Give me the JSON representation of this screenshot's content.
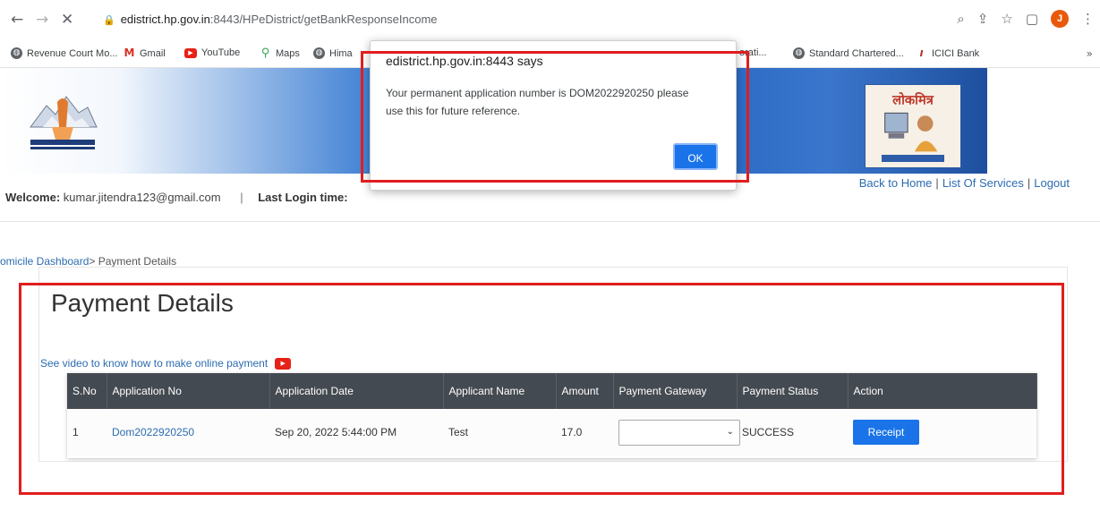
{
  "browser": {
    "url_domain": "edistrict.hp.gov.in",
    "url_path": ":8443/HPeDistrict/getBankResponseIncome",
    "avatar_letter": "J",
    "bookmarks": [
      "Revenue Court Mo...",
      "Gmail",
      "YouTube",
      "Maps",
      "Hima",
      "orati...",
      "Standard Chartered...",
      "ICICI Bank"
    ]
  },
  "header": {
    "welcome_label": "Welcome:",
    "welcome_user": "kumar.jitendra123@gmail.com",
    "separator": "|",
    "last_login_label": "Last Login time:",
    "links": [
      "Back to Home",
      "List Of Services",
      "Logout"
    ]
  },
  "breadcrumb": {
    "parent": "omicile Dashboard",
    "current": "> Payment Details"
  },
  "page": {
    "title": "Payment Details",
    "video_link": "See video to know how to make online payment"
  },
  "table": {
    "headers": [
      "S.No",
      "Application No",
      "Application Date",
      "Applicant Name",
      "Amount",
      "Payment Gateway",
      "Payment Status",
      "Action"
    ],
    "rows": [
      {
        "sno": "1",
        "application_no": "Dom2022920250",
        "application_date": "Sep 20, 2022 5:44:00 PM",
        "applicant_name": "Test",
        "amount": "17.0",
        "payment_gateway": "",
        "payment_status": "SUCCESS",
        "action_label": "Receipt"
      }
    ]
  },
  "dialog": {
    "title": "edistrict.hp.gov.in:8443 says",
    "message": "Your permanent application number is DOM2022920250 please use this for future reference.",
    "ok_label": "OK"
  },
  "colors": {
    "highlight": "#e11d1d",
    "primary_button": "#1a73e8",
    "table_header": "#444a51",
    "link": "#2c6cb0"
  }
}
